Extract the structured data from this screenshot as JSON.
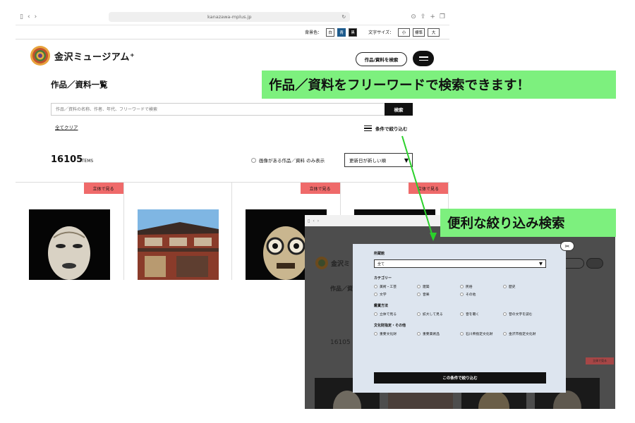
{
  "browser": {
    "url": "kanazawa-mplus.jp"
  },
  "prefs": {
    "bg_label": "背景色：",
    "bg_white": "白",
    "bg_blue": "青",
    "bg_black": "黒",
    "size_label": "文字サイズ：",
    "size_small": "小",
    "size_std": "標準",
    "size_large": "大"
  },
  "header": {
    "logo": "金沢ミュージアム⁺",
    "search_pill": "作品/資料を検索"
  },
  "main": {
    "title": "作品／資料一覧",
    "search_placeholder": "作品／資料の名称、作者、年代、フリーワードで検索",
    "search_button": "検索",
    "clear_all": "全てクリア",
    "filter_link": "条件で絞り込む",
    "count": "16105",
    "count_unit": "ITEMS",
    "image_only": "画像がある作品／資料 のみ表示",
    "sort": "更新日が新しい順"
  },
  "cards": [
    {
      "badge": "立体で見る"
    },
    {
      "badge": ""
    },
    {
      "badge": "立体で見る"
    },
    {
      "badge": "立体で見る"
    }
  ],
  "callouts": {
    "freeword": "作品／資料をフリーワードで検索できます！",
    "filter": "便利な絞り込み検索"
  },
  "background_page": {
    "logo": "金沢ミ",
    "title": "作品／資",
    "count": "16105",
    "badge": "立体で見る"
  },
  "modal": {
    "sections": {
      "holder": "所蔵館",
      "category": "カテゴリー",
      "viewing": "鑑賞方法",
      "cultural": "文化財指定・その他"
    },
    "holder_value": "全て",
    "category_options": [
      "美術・工芸",
      "建築",
      "民俗",
      "歴史",
      "文学",
      "音楽",
      "その他"
    ],
    "viewing_options": [
      "立体で見る",
      "拡大して見る",
      "音を聴く",
      "昔の文字を読む"
    ],
    "cultural_options": [
      "重要文化財",
      "重要美術品",
      "石川県指定文化財",
      "金沢市指定文化財"
    ],
    "apply_button": "この条件で絞り込む"
  },
  "colors": {
    "callout": "#7df07e",
    "badge": "#ef6a6a",
    "blue_pref": "#1e5b8c",
    "modal_bg": "#dde5ef"
  }
}
